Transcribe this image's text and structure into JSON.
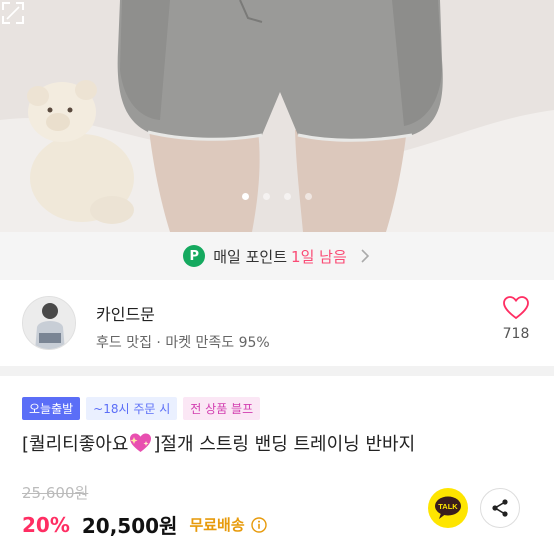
{
  "carousel": {
    "total": 4,
    "active_index": 0
  },
  "point_banner": {
    "badge": "P",
    "text": "매일 포인트",
    "remaining": "1일 남음"
  },
  "shop": {
    "name": "카인드문",
    "subtitle": "후드 맛집 · 마켓 만족도 95%",
    "like_count": "718"
  },
  "product": {
    "badges": {
      "today": "오늘출발",
      "order_cutoff": "~18시 주문 시",
      "sale": "전 상품 블프"
    },
    "title_prefix": "[퀄리티좋아요",
    "title_suffix": "]절개 스트링 밴딩 트레이닝 반바지",
    "original_price": "25,600원",
    "discount": "20%",
    "price": "20,500원",
    "shipping": "무료배송"
  },
  "kakao": {
    "label": "TALK"
  },
  "colors": {
    "point_green": "#15a95f",
    "accent_pink": "#ff2e63",
    "today_blue": "#5b6ef7",
    "ship_orange": "#e79a0b",
    "kakao_yellow": "#fee500"
  }
}
